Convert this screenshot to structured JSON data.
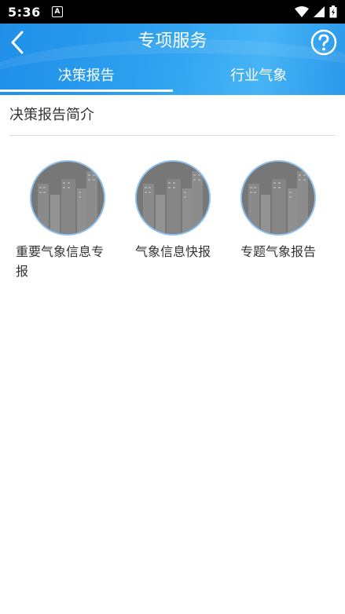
{
  "status_bar": {
    "time": "5:36",
    "notification_icon": "A"
  },
  "header": {
    "title": "专项服务",
    "back_icon": "chevron-left-icon",
    "help_icon": "question-circle-icon"
  },
  "tabs": [
    {
      "label": "决策报告",
      "active": true
    },
    {
      "label": "行业气象",
      "active": false
    }
  ],
  "section": {
    "title": "决策报告简介"
  },
  "items": [
    {
      "label": "重要气象信息专报",
      "thumbnail": "city-buildings-image"
    },
    {
      "label": "气象信息快报",
      "thumbnail": "city-buildings-image"
    },
    {
      "label": "专题气象报告",
      "thumbnail": "city-buildings-image"
    }
  ],
  "colors": {
    "header_blue": "#2ea2f0",
    "text": "#333333"
  }
}
